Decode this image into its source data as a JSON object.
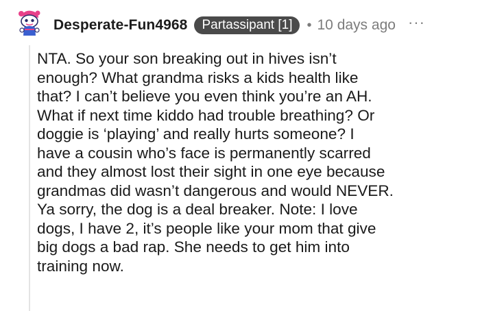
{
  "comment": {
    "username": "Desperate-Fun4968",
    "flair": "Partassipant [1]",
    "separator": "•",
    "timestamp": "10 days ago",
    "more_icon": "ellipsis-icon",
    "avatar_icon": "snoo-avatar-icon",
    "colors": {
      "flair_bg": "#4a4a4a",
      "avatar_pink": "#e8418a",
      "avatar_blue": "#3a5fd0"
    },
    "body_lines": [
      "NTA. So your son breaking out in hives isn’t",
      "enough? What grandma risks a kids health like",
      "that? I can’t believe you even think you’re an AH.",
      "What if next time kiddo had trouble breathing? Or",
      "doggie is ‘playing’ and really hurts someone? I",
      "have a cousin who’s face is permanently scarred",
      "and they almost lost their sight in one eye because",
      "grandmas did wasn’t dangerous and would NEVER.",
      "Ya sorry, the dog is a deal breaker. Note: I love",
      "dogs, I have 2, it’s people like your mom that give",
      "big dogs a bad rap. She needs to get him into",
      "training now."
    ]
  }
}
